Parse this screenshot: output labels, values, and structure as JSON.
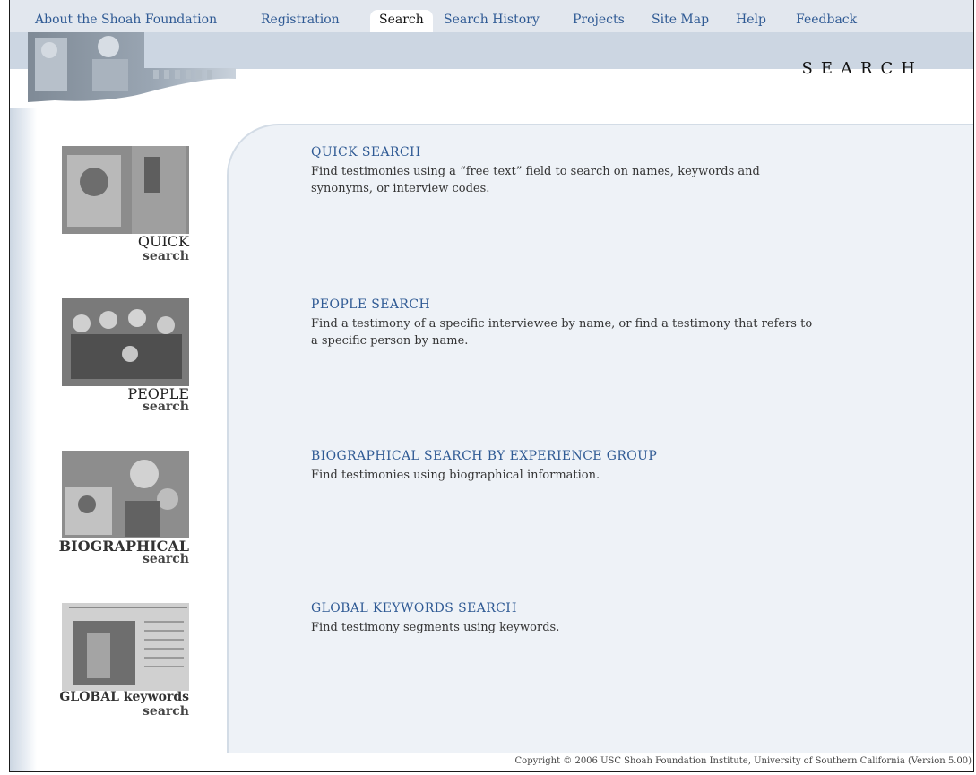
{
  "nav": {
    "items": [
      {
        "label": "About the Shoah Foundation",
        "active": false
      },
      {
        "label": "Registration",
        "active": false
      },
      {
        "label": "Search",
        "active": true
      },
      {
        "label": "Search History",
        "active": false
      },
      {
        "label": "Projects",
        "active": false
      },
      {
        "label": "Site Map",
        "active": false
      },
      {
        "label": "Help",
        "active": false
      },
      {
        "label": "Feedback",
        "active": false
      }
    ]
  },
  "header": {
    "title": "SEARCH"
  },
  "rail": {
    "items": [
      {
        "line1": "QUICK",
        "line2": "search"
      },
      {
        "line1": "PEOPLE",
        "line2": "search"
      },
      {
        "line1": "BIOGRAPHICAL",
        "line2": "search"
      },
      {
        "line1": "GLOBAL keywords",
        "line2": "search"
      }
    ]
  },
  "sections": [
    {
      "title": "QUICK SEARCH",
      "description": "Find testimonies using a “free text” field to search on names, keywords and synonyms, or interview codes."
    },
    {
      "title": "PEOPLE SEARCH",
      "description": "Find a testimony of a specific interviewee by name, or find a testimony that refers to a specific person by name."
    },
    {
      "title": "BIOGRAPHICAL SEARCH BY EXPERIENCE GROUP",
      "description": "Find testimonies using biographical information."
    },
    {
      "title": "GLOBAL KEYWORDS SEARCH",
      "description": "Find testimony segments using keywords."
    }
  ],
  "footer": {
    "copyright": "Copyright © 2006 USC Shoah Foundation Institute, University of Southern California (Version 5.00)"
  },
  "colors": {
    "link": "#2f5a94",
    "nav_bg": "#e2e7ee",
    "band": "#ccd6e2",
    "panel": "#eef2f7"
  }
}
